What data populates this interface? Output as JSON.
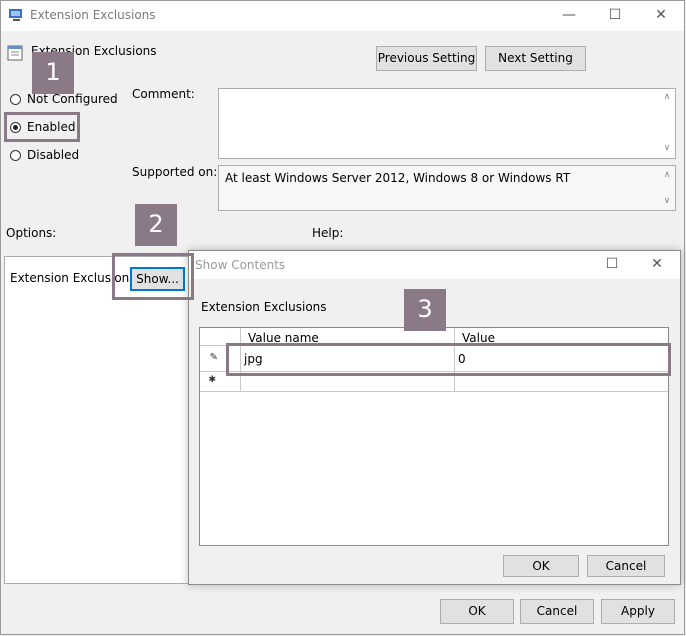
{
  "window": {
    "title": "Extension Exclusions",
    "setting_name": "Extension Exclusions",
    "prev_button": "Previous Setting",
    "next_button": "Next Setting",
    "minimize_icon": "minimize-icon",
    "maximize_icon": "maximize-icon",
    "close_icon": "close-icon"
  },
  "state": {
    "options": [
      "Not Configured",
      "Enabled",
      "Disabled"
    ],
    "selected": "Enabled"
  },
  "comment": {
    "label": "Comment:",
    "value": ""
  },
  "supported": {
    "label": "Supported on:",
    "value": "At least Windows Server 2012, Windows 8 or Windows RT"
  },
  "options_label": "Options:",
  "help_label": "Help:",
  "options_panel": {
    "item_label": "Extension Exclusions",
    "show_button": "Show..."
  },
  "footer": {
    "ok": "OK",
    "cancel": "Cancel",
    "apply": "Apply"
  },
  "dialog": {
    "title": "Show Contents",
    "list_label": "Extension Exclusions",
    "columns": [
      "Value name",
      "Value"
    ],
    "rows": [
      {
        "marker": "✎",
        "name": "jpg",
        "value": "0"
      },
      {
        "marker": "✱",
        "name": "",
        "value": ""
      }
    ],
    "ok": "OK",
    "cancel": "Cancel"
  },
  "callouts": [
    "1",
    "2",
    "3"
  ]
}
